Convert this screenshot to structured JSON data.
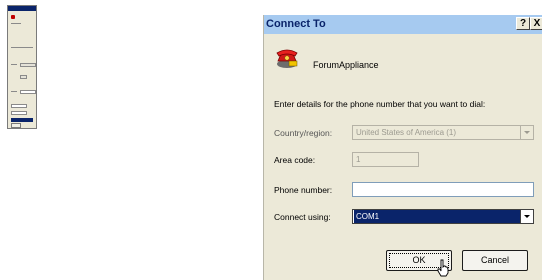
{
  "dialog": {
    "title": "Connect To",
    "help_button": "?",
    "close_button": "X",
    "icon": "phone-icon",
    "connection_name": "ForumAppliance",
    "instructions": "Enter details for the phone number that you want to dial:",
    "country_label": "Country/region:",
    "country_value": "United States of America (1)",
    "area_code_label": "Area code:",
    "area_code_value": "1",
    "phone_label": "Phone number:",
    "phone_value": "",
    "connect_using_label": "Connect using:",
    "connect_using_value": "COM1",
    "ok_label": "OK",
    "cancel_label": "Cancel"
  },
  "colors": {
    "titlebar": "#a6caf0",
    "title_text": "#0a246a",
    "dialog_bg": "#ece9d8",
    "selection": "#0a246a"
  }
}
